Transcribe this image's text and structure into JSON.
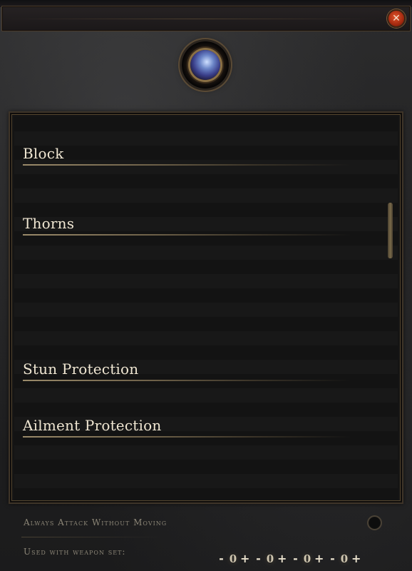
{
  "header": {
    "close_glyph": "✕",
    "emblem_icon": "orb-icon"
  },
  "sections": [
    {
      "label": "Block"
    },
    {
      "label": "Thorns"
    },
    {
      "label": "Stun Protection"
    },
    {
      "label": "Ailment Protection"
    }
  ],
  "footer": {
    "always_attack_label": "Always Attack Without Moving",
    "always_attack_enabled": false,
    "weapon_set_label": "Used with weapon set:",
    "weapon_sets": [
      {
        "minus": "-",
        "value": "0",
        "plus": "+"
      },
      {
        "minus": "-",
        "value": "0",
        "plus": "+"
      },
      {
        "minus": "-",
        "value": "0",
        "plus": "+"
      },
      {
        "minus": "-",
        "value": "0",
        "plus": "+"
      }
    ]
  },
  "colors": {
    "heading_text": "#efe6d2",
    "footer_text": "#8b8576",
    "close_button": "#c23a18",
    "frame_gold": "#55462f"
  }
}
